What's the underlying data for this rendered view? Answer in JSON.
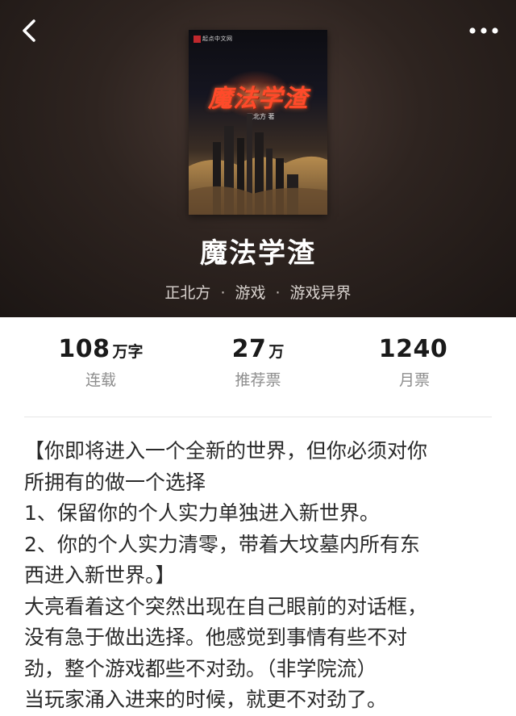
{
  "nav": {
    "back_icon": "chevron-left-icon",
    "more_icon": "more-dots-icon"
  },
  "cover": {
    "publisher": "起点中文网",
    "title": "魔法学渣",
    "author": "正北方 著"
  },
  "book": {
    "title": "魔法学渣",
    "author": "正北方",
    "category": "游戏",
    "subcategory": "游戏异界",
    "separator": "·"
  },
  "stats": [
    {
      "value": "108",
      "unit": "万字",
      "label": "连载"
    },
    {
      "value": "27",
      "unit": "万",
      "label": "推荐票"
    },
    {
      "value": "1240",
      "unit": "",
      "label": "月票"
    }
  ],
  "synopsis": {
    "lines": [
      "【你即将进入一个全新的世界，但你必须对你",
      "所拥有的做一个选择",
      "1、保留你的个人实力单独进入新世界。",
      "2、你的个人实力清零，带着大坟墓内所有东",
      "西进入新世界。】",
      "大亮看着这个突然出现在自己眼前的对话框，",
      "没有急于做出选择。他感觉到事情有些不对",
      "劲，整个游戏都些不对劲。（非学院流）",
      "当玩家涌入进来的时候，就更不对劲了。"
    ]
  },
  "colors": {
    "header_bg": "#2e2420",
    "text_primary": "#1a1a1a",
    "text_secondary": "#8d8d8d",
    "cover_title": "#ff4a2a"
  }
}
